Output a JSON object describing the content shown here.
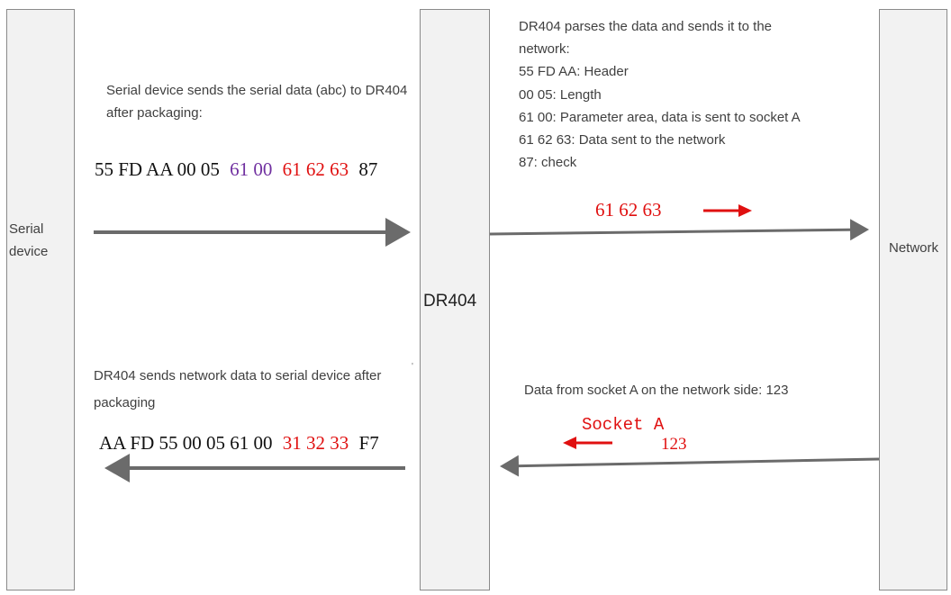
{
  "lanes": {
    "serial_device": "Serial device",
    "dr404": "DR404",
    "network": "Network"
  },
  "top_left_note": "Serial device sends the serial data (abc) to DR404 after packaging:",
  "top_packet": [
    {
      "text": "55 FD AA 00 05",
      "color": "#111111"
    },
    {
      "text": "61 00",
      "color": "#7030a0"
    },
    {
      "text": "61 62 63",
      "color": "#e01010"
    },
    {
      "text": "87",
      "color": "#111111"
    }
  ],
  "top_right_note": {
    "line1": "DR404 parses the data and sends it to the",
    "line2": "network:",
    "line3": "55 FD AA: Header",
    "line4": "00 05: Length",
    "line5": "61 00: Parameter area, data is sent to socket A",
    "line6": "61 62 63: Data sent to the network",
    "line7": "87: check"
  },
  "data_to_network": "61 62 63",
  "bottom_left_note": "DR404 sends network data to serial device after packaging",
  "bottom_packet": [
    {
      "text": "AA FD 55 00 05 61 00",
      "color": "#111111"
    },
    {
      "text": "31 32 33",
      "color": "#e01010"
    },
    {
      "text": "F7",
      "color": "#111111"
    }
  ],
  "bottom_right_note": "Data from socket A on the network side: 123",
  "socket_label": "Socket A",
  "socket_value": "123",
  "colors": {
    "arrow": "#6b6b6b",
    "accent_red": "#e01010",
    "purple": "#7030a0"
  }
}
